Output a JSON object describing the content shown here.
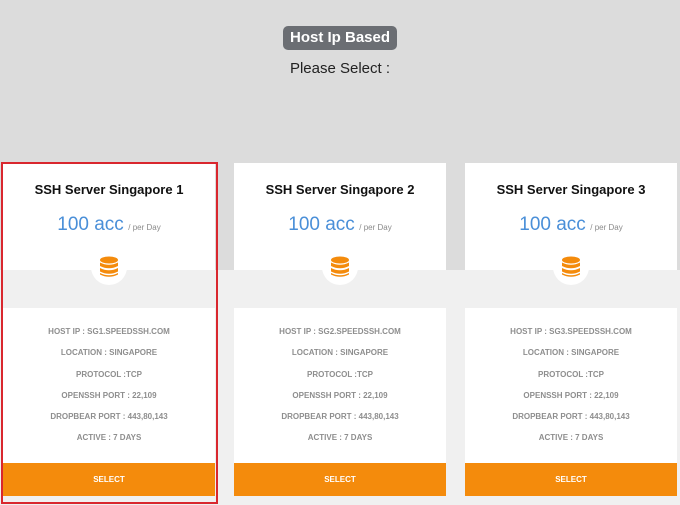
{
  "header": {
    "badge": "Host Ip Based",
    "subtitle": "Please Select :"
  },
  "colors": {
    "accent": "#f48b0c",
    "price": "#4a8fd8",
    "selection_border": "#d9272e"
  },
  "icons": {
    "server": "database-icon"
  },
  "cards": [
    {
      "title": "SSH Server Singapore 1",
      "price": "100 acc",
      "per": "/ per Day",
      "host": "HOST IP : SG1.SPEEDSSH.COM",
      "location": "LOCATION : SINGAPORE",
      "protocol": "PROTOCOL :TCP",
      "openssh": "OPENSSH PORT : 22,109",
      "dropbear": "DROPBEAR PORT : 443,80,143",
      "active": "ACTIVE : 7 DAYS",
      "button": "SELECT",
      "selected": true
    },
    {
      "title": "SSH Server Singapore 2",
      "price": "100 acc",
      "per": "/ per Day",
      "host": "HOST IP : SG2.SPEEDSSH.COM",
      "location": "LOCATION : SINGAPORE",
      "protocol": "PROTOCOL :TCP",
      "openssh": "OPENSSH PORT : 22,109",
      "dropbear": "DROPBEAR PORT : 443,80,143",
      "active": "ACTIVE : 7 DAYS",
      "button": "SELECT",
      "selected": false
    },
    {
      "title": "SSH Server Singapore 3",
      "price": "100 acc",
      "per": "/ per Day",
      "host": "HOST IP : SG3.SPEEDSSH.COM",
      "location": "LOCATION : SINGAPORE",
      "protocol": "PROTOCOL :TCP",
      "openssh": "OPENSSH PORT : 22,109",
      "dropbear": "DROPBEAR PORT : 443,80,143",
      "active": "ACTIVE : 7 DAYS",
      "button": "SELECT",
      "selected": false
    }
  ]
}
